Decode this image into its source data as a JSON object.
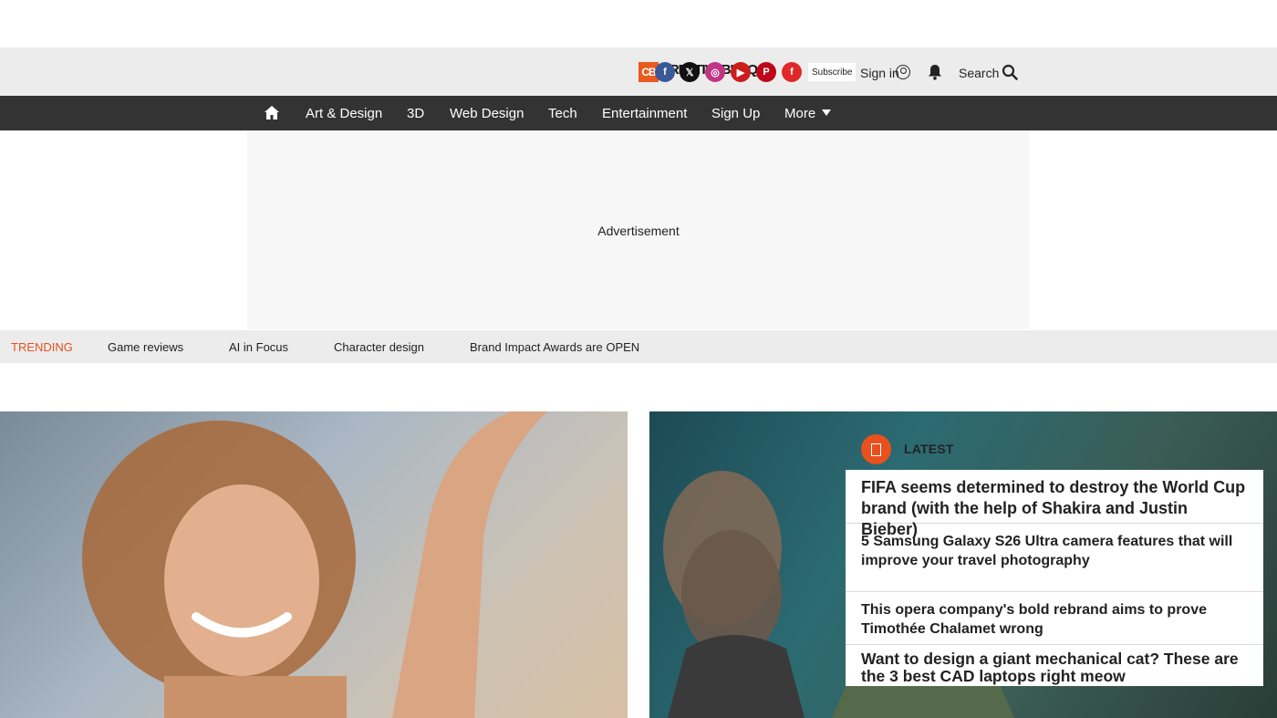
{
  "brand": {
    "logo_text": "CB",
    "wordmark": "CREATIVEBLOQ",
    "accent": "#e8501e"
  },
  "topbar": {
    "socials": [
      {
        "name": "facebook-icon",
        "glyph": "f",
        "color": "#3b5998"
      },
      {
        "name": "x-icon",
        "glyph": "𝕏",
        "color": "#111111"
      },
      {
        "name": "instagram-icon",
        "glyph": "◎",
        "color": "#c13584"
      },
      {
        "name": "youtube-icon",
        "glyph": "▶",
        "color": "#cc1c1c"
      },
      {
        "name": "pinterest-icon",
        "glyph": "P",
        "color": "#bd081c"
      },
      {
        "name": "flipboard-icon",
        "glyph": "f",
        "color": "#e12828"
      }
    ],
    "subscribe": "Subscribe",
    "signin": "Sign in",
    "search": "Search"
  },
  "nav": {
    "items": [
      "Art & Design",
      "3D",
      "Web Design",
      "Tech",
      "Entertainment",
      "Sign Up",
      "More"
    ]
  },
  "ad": {
    "label": "Advertisement"
  },
  "trending": {
    "label": "TRENDING",
    "links": [
      "Game reviews",
      "AI in Focus",
      "Character design",
      "Brand Impact Awards are OPEN"
    ]
  },
  "latest": {
    "title": "LATEST",
    "items": [
      "FIFA seems determined to destroy the World Cup brand (with the help of Shakira and Justin Bieber)",
      "5 Samsung Galaxy S26 Ultra camera features that will improve your travel photography",
      "This opera company's bold rebrand aims to prove Timothée Chalamet wrong",
      "Want to design a giant mechanical cat? These are the 3 best CAD laptops right meow"
    ]
  }
}
